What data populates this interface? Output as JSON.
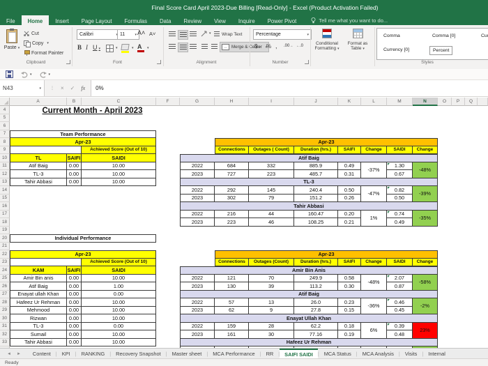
{
  "titlebar": {
    "title": "Final Score Card April 2023-Due Billing  [Read-Only] - Excel (Product Activation Failed)"
  },
  "ribbon_tabs": [
    {
      "label": "File",
      "active": false
    },
    {
      "label": "Home",
      "active": true
    },
    {
      "label": "Insert",
      "active": false
    },
    {
      "label": "Page Layout",
      "active": false
    },
    {
      "label": "Formulas",
      "active": false
    },
    {
      "label": "Data",
      "active": false
    },
    {
      "label": "Review",
      "active": false
    },
    {
      "label": "View",
      "active": false
    },
    {
      "label": "Inquire",
      "active": false
    },
    {
      "label": "Power Pivot",
      "active": false
    }
  ],
  "tell_me": "Tell me what you want to do...",
  "ribbon": {
    "clipboard": {
      "label": "Clipboard",
      "paste": "Paste",
      "cut": "Cut",
      "copy": "Copy",
      "format_painter": "Format Painter"
    },
    "font": {
      "label": "Font",
      "font_name": "Calibri",
      "font_size": "11"
    },
    "alignment": {
      "label": "Alignment",
      "wrap_text": "Wrap Text",
      "merge_center": "Merge & Center"
    },
    "number": {
      "label": "Number",
      "format": "Percentage"
    },
    "styles": {
      "label": "Styles",
      "conditional_1": "Conditional",
      "conditional_2": "Formatting",
      "format_table_1": "Format as",
      "format_table_2": "Table",
      "gallery": [
        {
          "label": "Comma",
          "selected": false
        },
        {
          "label": "Comma [0]",
          "selected": false
        },
        {
          "label": "Currency",
          "selected": false
        },
        {
          "label": "Currency [0]",
          "selected": false
        },
        {
          "label": "Percent",
          "selected": true
        }
      ]
    }
  },
  "formula_bar": {
    "name_box": "N43",
    "value": "0%"
  },
  "grid": {
    "col_letters": [
      "A",
      "B",
      "C",
      "F",
      "G",
      "H",
      "I",
      "J",
      "K",
      "L",
      "M",
      "N",
      "O",
      "P",
      "Q"
    ],
    "selected_col": "N",
    "row_numbers": [
      4,
      5,
      6,
      7,
      8,
      9,
      10,
      11,
      12,
      13,
      14,
      15,
      16,
      17,
      18,
      19,
      20,
      21,
      22,
      23,
      24,
      25,
      26,
      27,
      28,
      29,
      30,
      31,
      32,
      33
    ]
  },
  "sheet": {
    "title": "Current Month - April 2023",
    "team": {
      "header": "Team Performance",
      "period": "Apr-23",
      "score_header": "Achieved Score (Out of 10)",
      "cols": [
        "TL",
        "SAIFI",
        "SAIDI"
      ],
      "rows": [
        [
          "Atif Baig",
          "0.00",
          "10.00"
        ],
        [
          "TL-3",
          "0.00",
          "10.00"
        ],
        [
          "Tahir Abbasi",
          "0.00",
          "10.00"
        ]
      ]
    },
    "individual": {
      "header": "Individual Performance",
      "period": "Apr-23",
      "score_header": "Achieved Score (Out of 10)",
      "cols": [
        "KAM",
        "SAIFI",
        "SAIDI"
      ],
      "rows": [
        [
          "Amir Bin anis",
          "0.00",
          "10.00"
        ],
        [
          "Atif Baig",
          "0.00",
          "1.00"
        ],
        [
          "Enayat ullah Khan",
          "0.00",
          "0.00"
        ],
        [
          "Hafeez Ur Rehman",
          "0.00",
          "10.00"
        ],
        [
          "Mehmood",
          "0.00",
          "10.00"
        ],
        [
          "Rizwan",
          "0.00",
          "10.00"
        ],
        [
          "TL-3",
          "0.00",
          "0.00"
        ],
        [
          "Sumail",
          "0.00",
          "10.00"
        ],
        [
          "Tahir Abbasi",
          "0.00",
          "10.00"
        ]
      ]
    },
    "team_detail": {
      "period": "Apr-23",
      "headers": [
        "Connections",
        "Outages ( Count)",
        "Duration (hrs.)",
        "SAIFI",
        "Change",
        "SAIDI",
        "Change"
      ],
      "sections": [
        {
          "name": "Atif Baig",
          "saifi_change": "-37%",
          "saidi_change": "-48%",
          "saidi_change_color": "green",
          "rows": [
            [
              "2022",
              "684",
              "332",
              "885.9",
              "0.49",
              "1.30"
            ],
            [
              "2023",
              "727",
              "223",
              "485.7",
              "0.31",
              "0.67"
            ]
          ]
        },
        {
          "name": "TL-3",
          "saifi_change": "-47%",
          "saidi_change": "-39%",
          "saidi_change_color": "green",
          "rows": [
            [
              "2022",
              "292",
              "145",
              "240.4",
              "0.50",
              "0.82"
            ],
            [
              "2023",
              "302",
              "79",
              "151.2",
              "0.26",
              "0.50"
            ]
          ]
        },
        {
          "name": "Tahir Abbasi",
          "saifi_change": "1%",
          "saidi_change": "-35%",
          "saidi_change_color": "green",
          "rows": [
            [
              "2022",
              "216",
              "44",
              "160.47",
              "0.20",
              "0.74"
            ],
            [
              "2023",
              "223",
              "46",
              "108.25",
              "0.21",
              "0.49"
            ]
          ]
        }
      ]
    },
    "individual_detail": {
      "period": "Apr-23",
      "headers": [
        "Connections",
        "Outages (Count)",
        "Duration (hrs.)",
        "SAIFI",
        "Change",
        "SAIDI",
        "Change"
      ],
      "sections": [
        {
          "name": "Amir Bin Anis",
          "saifi_change": "-48%",
          "saidi_change": "-58%",
          "saidi_change_color": "green",
          "rows": [
            [
              "2022",
              "121",
              "70",
              "249.9",
              "0.58",
              "2.07"
            ],
            [
              "2023",
              "130",
              "39",
              "113.2",
              "0.30",
              "0.87"
            ]
          ]
        },
        {
          "name": "Atif Baig",
          "saifi_change": "-36%",
          "saidi_change": "-2%",
          "saidi_change_color": "green",
          "rows": [
            [
              "2022",
              "57",
              "13",
              "26.0",
              "0.23",
              "0.46"
            ],
            [
              "2023",
              "62",
              "9",
              "27.8",
              "0.15",
              "0.45"
            ]
          ]
        },
        {
          "name": "Enayat Ullah Khan",
          "saifi_change": "6%",
          "saidi_change": "23%",
          "saidi_change_color": "red",
          "rows": [
            [
              "2022",
              "159",
              "28",
              "62.2",
              "0.18",
              "0.39"
            ],
            [
              "2023",
              "161",
              "30",
              "77.16",
              "0.19",
              "0.48"
            ]
          ]
        },
        {
          "name": "Hafeez Ur Rehman",
          "rows": []
        }
      ]
    }
  },
  "sheet_tabs": [
    {
      "label": "Content",
      "active": false
    },
    {
      "label": "KPI",
      "active": false
    },
    {
      "label": "RANKING",
      "active": false
    },
    {
      "label": "Recovery Snapshot",
      "active": false
    },
    {
      "label": "Master sheet",
      "active": false
    },
    {
      "label": "MCA Performance",
      "active": false
    },
    {
      "label": "RR",
      "active": false
    },
    {
      "label": "SAIFI SAIDI",
      "active": true
    },
    {
      "label": "MCA Status",
      "active": false
    },
    {
      "label": "MCA Analysis",
      "active": false
    },
    {
      "label": "Visits",
      "active": false
    },
    {
      "label": "Internal",
      "active": false
    }
  ],
  "status_bar": {
    "ready": "Ready"
  },
  "colors": {
    "excel_green": "#217346",
    "header_yellow": "#FFFF00",
    "header_orange": "#FFC000",
    "name_lavender": "#D9D9EE",
    "good_green": "#92D050",
    "bad_red": "#FF0000"
  }
}
